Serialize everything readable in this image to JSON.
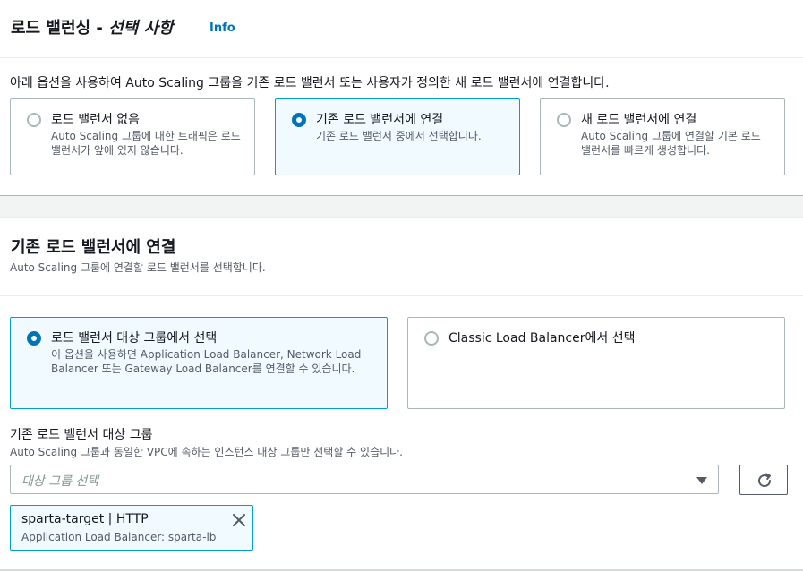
{
  "lb_section": {
    "title": "로드 밸런싱 - ",
    "title_optional": "선택 사항",
    "info_link": "Info",
    "description": "아래 옵션을 사용하여 Auto Scaling 그룹을 기존 로드 밸런서 또는 사용자가 정의한 새 로드 밸런서에 연결합니다.",
    "options": [
      {
        "label": "로드 밸런서 없음",
        "description": "Auto Scaling 그룹에 대한 트래픽은 로드 밸런서가 앞에 있지 않습니다.",
        "selected": false
      },
      {
        "label": "기존 로드 밸런서에 연결",
        "description": "기존 로드 밸런서 중에서 선택합니다.",
        "selected": true
      },
      {
        "label": "새 로드 밸런서에 연결",
        "description": "Auto Scaling 그룹에 연결할 기본 로드 밸런서를 빠르게 생성합니다.",
        "selected": false
      }
    ]
  },
  "attach_section": {
    "title": "기존 로드 밸런서에 연결",
    "description": "Auto Scaling 그룹에 연결할 로드 밸런서를 선택합니다.",
    "source_options": [
      {
        "label": "로드 밸런서 대상 그룹에서 선택",
        "description": "이 옵션을 사용하면 Application Load Balancer, Network Load Balancer 또는 Gateway Load Balancer를 연결할 수 있습니다.",
        "selected": true
      },
      {
        "label": "Classic Load Balancer에서 선택",
        "description": "",
        "selected": false
      }
    ],
    "target_group_field": {
      "label": "기존 로드 밸런서 대상 그룹",
      "description": "Auto Scaling 그룹과 동일한 VPC에 속하는 인스턴스 대상 그룹만 선택할 수 있습니다.",
      "placeholder": "대상 그룹 선택",
      "refresh_icon": "refresh-icon"
    },
    "selected_tokens": [
      {
        "name": "sparta-target | HTTP",
        "detail": "Application Load Balancer: sparta-lb"
      }
    ]
  },
  "colors": {
    "accent": "#0073bb",
    "selected_border": "#00a1c9",
    "selected_bg": "#f1faff",
    "border": "#aab7b8",
    "muted_text": "#545b64"
  }
}
